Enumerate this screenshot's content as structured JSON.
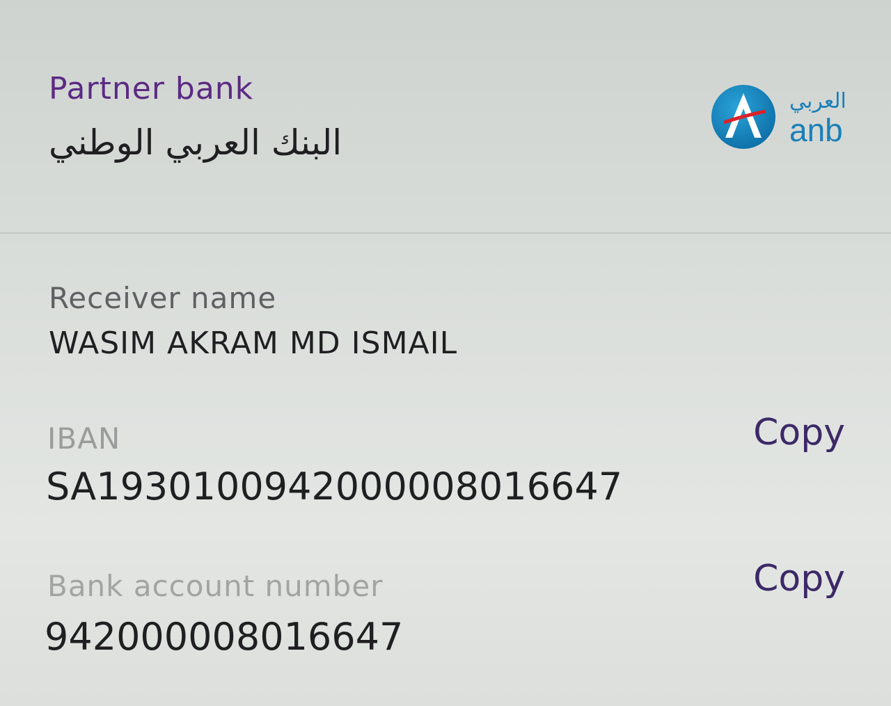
{
  "partner": {
    "label": "Partner bank",
    "bank_name": "البنك العربي الوطني",
    "logo": {
      "icon": "anb-logo-icon",
      "arabic": "العربي",
      "latin": "anb"
    }
  },
  "receiver": {
    "label": "Receiver name",
    "value": "WASIM AKRAM MD ISMAIL"
  },
  "iban": {
    "label": "IBAN",
    "value": "SA1930100942000008016647",
    "copy_label": "Copy"
  },
  "account": {
    "label": "Bank account number",
    "value": "942000008016647",
    "copy_label": "Copy"
  },
  "colors": {
    "label_purple": "#5b2a83",
    "copy_purple": "#3c2867",
    "logo_blue": "#1a7fb8"
  }
}
